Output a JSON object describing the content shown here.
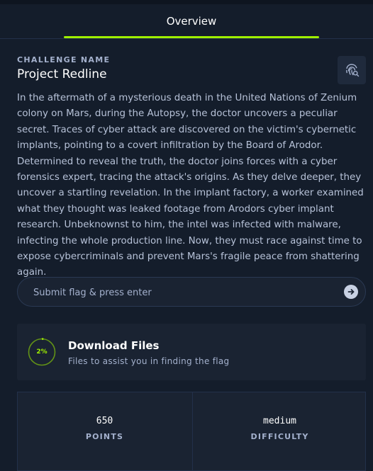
{
  "tabs": {
    "overview": "Overview"
  },
  "challenge": {
    "label": "CHALLENGE NAME",
    "name": "Project Redline",
    "description": "In the aftermath of a mysterious death in the United Nations of Zenium colony on Mars, during the Autopsy, the doctor uncovers a peculiar secret. Traces of cyber attack are discovered on the victim's cybernetic implants, pointing to a covert infiltration by the Board of Arodor. Determined to reveal the truth, the doctor joins forces with a cyber forensics expert, tracing the attack's origins. As they delve deeper, they uncover a startling revelation. In the implant factory, a worker examined what they thought was leaked footage from Arodors cyber implant research. Unbeknownst to him, the intel was infected with malware, infecting the whole production line. Now, they must race against time to expose cybercriminals and prevent Mars's fragile peace from shattering again.",
    "action_icon": "fingerprint-search-icon"
  },
  "flag": {
    "placeholder": "Submit flag & press enter",
    "value": "",
    "submit_icon": "arrow-right-icon"
  },
  "download": {
    "progress_label": "2%",
    "progress": 0.02,
    "title": "Download Files",
    "subtitle": "Files to assist you in finding the flag"
  },
  "stats": {
    "points_value": "650",
    "points_label": "POINTS",
    "difficulty_value": "medium",
    "difficulty_label": "DIFFICULTY"
  },
  "colors": {
    "accent": "#9fef00",
    "background": "#141d2b",
    "card": "#1a2332"
  }
}
